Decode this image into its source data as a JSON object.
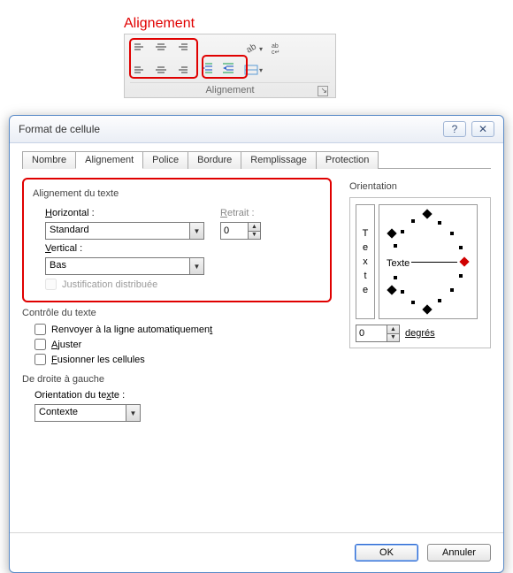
{
  "annotations": {
    "alignement": "Alignement",
    "retrait": "Retrait"
  },
  "ribbon": {
    "group_label": "Alignement"
  },
  "dialog": {
    "title": "Format de cellule",
    "tabs": [
      "Nombre",
      "Alignement",
      "Police",
      "Bordure",
      "Remplissage",
      "Protection"
    ],
    "active_tab_index": 1,
    "text_align": {
      "section_title": "Alignement du texte",
      "horizontal_label": "Horizontal :",
      "horizontal_value": "Standard",
      "vertical_label": "Vertical :",
      "vertical_value": "Bas",
      "retrait_label": "Retrait :",
      "retrait_value": "0",
      "justif_distrib": "Justification distribuée"
    },
    "text_control": {
      "section_title": "Contrôle du texte",
      "wrap": "Renvoyer à la ligne automatiquement",
      "shrink": "Ajuster",
      "merge": "Fusionner les cellules"
    },
    "rtl": {
      "section_title": "De droite à gauche",
      "orientation_label": "Orientation du texte :",
      "orientation_value": "Contexte"
    },
    "orientation": {
      "title": "Orientation",
      "vertical_chars": [
        "T",
        "e",
        "x",
        "t",
        "e"
      ],
      "dial_label": "Texte",
      "degrees_value": "0",
      "degrees_label": "degrés"
    },
    "buttons": {
      "ok": "OK",
      "cancel": "Annuler"
    }
  }
}
